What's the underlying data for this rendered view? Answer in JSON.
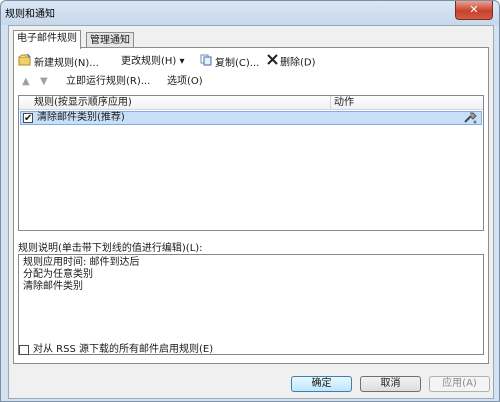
{
  "window": {
    "title": "规则和通知",
    "close_glyph": "✕"
  },
  "tabs": [
    {
      "label": "电子邮件规则",
      "active": true
    },
    {
      "label": "管理通知",
      "active": false
    }
  ],
  "toolbar": {
    "new_rule": "新建规则(N)...",
    "change_rule": "更改规则(H)",
    "dropdown_arrow": "▾",
    "copy": "复制(C)...",
    "delete": "删除(D)",
    "move_up_glyph": "▲",
    "move_down_glyph": "▼",
    "run_rules": "立即运行规则(R)...",
    "options": "选项(O)"
  },
  "rules_table": {
    "columns": [
      "规则(按显示顺序应用)",
      "动作"
    ],
    "rows": [
      {
        "name": "清除邮件类别(推荐)",
        "checked": true,
        "check_glyph": "✔"
      }
    ]
  },
  "description": {
    "label": "规则说明(单击带下划线的值进行编辑)(L):",
    "lines": [
      "规则应用时间: 邮件到达后",
      "分配为任意类别",
      "清除邮件类别"
    ]
  },
  "rss": {
    "label": "对从 RSS 源下载的所有邮件启用规则(E)",
    "checked": false
  },
  "buttons": {
    "ok": "确定",
    "cancel": "取消",
    "apply": "应用(A)"
  },
  "colors": {
    "selection": "#c7dff8",
    "title_bar": "#c7d8ec",
    "close_button": "#c7412b"
  }
}
